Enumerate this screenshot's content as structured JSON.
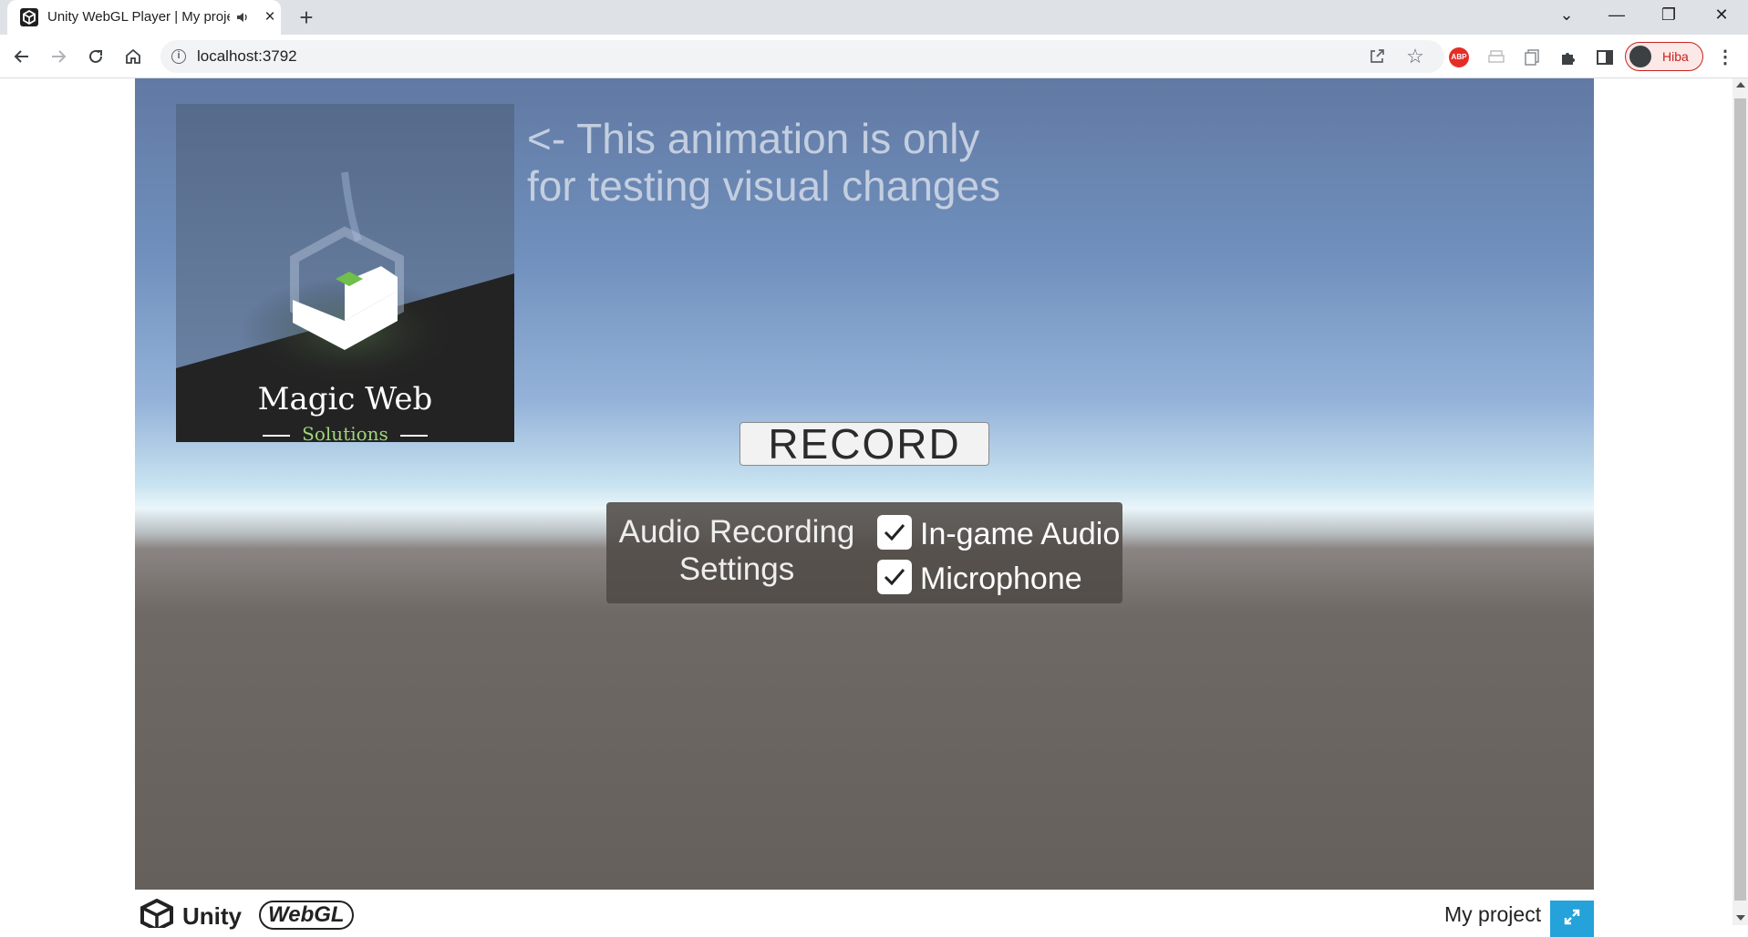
{
  "browser": {
    "tab_title": "Unity WebGL Player | My project",
    "url": "localhost:3792",
    "profile_name": "Hiba",
    "abp_label": "ABP"
  },
  "page": {
    "logo": {
      "headline": "Magic Web",
      "subline": "Solutions"
    },
    "note_text": "<- This animation is only for testing visual changes",
    "record_label": "RECORD",
    "audio_settings": {
      "title": "Audio Recording Settings",
      "options": [
        {
          "label": "In-game Audio",
          "checked": true
        },
        {
          "label": "Microphone",
          "checked": true
        }
      ]
    },
    "footer": {
      "unity_brand": "Unity",
      "webgl_brand": "WebGL",
      "project_name": "My project"
    }
  },
  "colors": {
    "fullscreen_button": "#24a2d9",
    "logo_accent": "#6fbf4a",
    "profile_accent": "#c5221f"
  }
}
